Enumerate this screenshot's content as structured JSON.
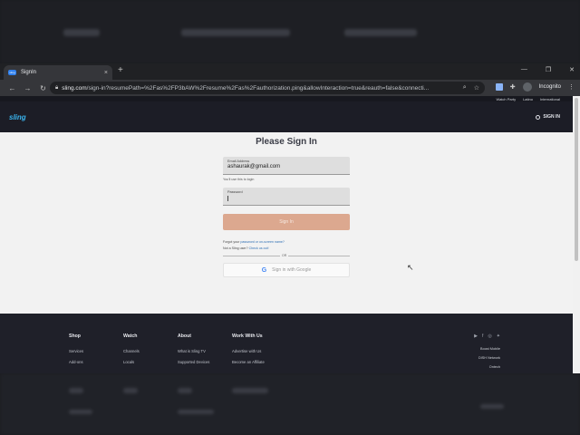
{
  "browser": {
    "tab_title": "SignIn",
    "tab_favicon": "sling",
    "tab_close": "×",
    "new_tab": "+",
    "url_host": "sling.com",
    "url_rest": "/sign-in?resumePath=%2Fas%2FP3bAW%2Fresume%2Fas%2Fauthorization.ping&allowInteraction=true&reauth=false&connecti...",
    "profile_label": "Incognito",
    "icons": [
      "back-arrow-icon",
      "forward-arrow-icon",
      "reload-icon",
      "lock-icon",
      "search-icon",
      "star-icon",
      "extension-icon",
      "puzzle-icon",
      "menu-dots-icon"
    ]
  },
  "site": {
    "topnav": [
      "Watch Party",
      "Latino",
      "International"
    ],
    "logo": "sling",
    "signin_link": "SIGN IN"
  },
  "form": {
    "heading": "Please Sign In",
    "email_label": "Email Address",
    "email_value": "ashaurak@gmail.com",
    "email_hint": "You'll use this to login",
    "password_label": "Password",
    "signin_button": "Sign In",
    "forgot_prefix": "Forgot your",
    "forgot_link": "password or on-screen name?",
    "new_prefix": "Not a Sling user?",
    "new_link": "Check us out!",
    "or_text": "OR",
    "google_button": "Sign in with Google"
  },
  "footer": {
    "columns": [
      {
        "heading": "Shop",
        "items": [
          "Services",
          "Add-ons"
        ]
      },
      {
        "heading": "Watch",
        "items": [
          "Channels",
          "Locals"
        ]
      },
      {
        "heading": "About",
        "items": [
          "What is Sling TV",
          "Supported Devices"
        ]
      },
      {
        "heading": "Work With Us",
        "items": [
          "Advertise with Us",
          "Become an Affiliate"
        ]
      }
    ],
    "social_icons": [
      "youtube-icon",
      "facebook-icon",
      "instagram-icon",
      "twitter-icon"
    ],
    "partners": [
      "Boost Mobile",
      "DISH Network",
      "Ontech"
    ]
  },
  "colors": {
    "signin_button": "#dca88f",
    "logo": "#3ab6f1",
    "footer_bg": "#1f2029"
  }
}
